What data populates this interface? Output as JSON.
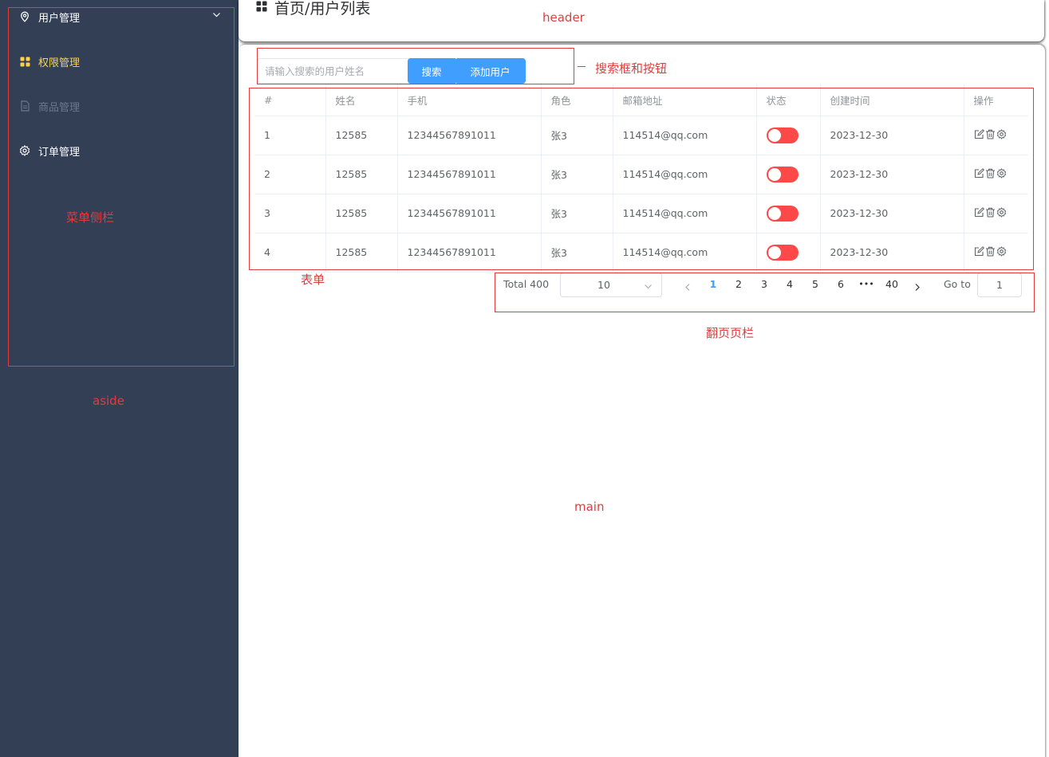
{
  "colors": {
    "aside_bg": "#323f55",
    "menu_active": "#ffd04b",
    "menu_disabled": "#6b778c",
    "primary": "#409eff",
    "switch_off": "#ff4949",
    "annotation": "#e23c3c"
  },
  "sidebar": {
    "items": [
      {
        "label": "用户管理",
        "icon": "location-icon",
        "has_submenu": true
      },
      {
        "label": "权限管理",
        "icon": "grid-icon",
        "active": true
      },
      {
        "label": "商品管理",
        "icon": "document-icon",
        "disabled": true
      },
      {
        "label": "订单管理",
        "icon": "gear-icon"
      }
    ]
  },
  "header": {
    "icon": "grid-icon",
    "breadcrumb": "首页/用户列表"
  },
  "search": {
    "placeholder": "请输入搜索的用户姓名",
    "value": "",
    "search_button": "搜索",
    "add_button": "添加用户"
  },
  "table": {
    "columns": [
      "#",
      "姓名",
      "手机",
      "角色",
      "邮箱地址",
      "状态",
      "创建时间",
      "操作"
    ],
    "rows": [
      {
        "index": "1",
        "name": "12585",
        "phone": "12344567891011",
        "role": "张3",
        "email": "114514@qq.com",
        "status": false,
        "created": "2023-12-30"
      },
      {
        "index": "2",
        "name": "12585",
        "phone": "12344567891011",
        "role": "张3",
        "email": "114514@qq.com",
        "status": false,
        "created": "2023-12-30"
      },
      {
        "index": "3",
        "name": "12585",
        "phone": "12344567891011",
        "role": "张3",
        "email": "114514@qq.com",
        "status": false,
        "created": "2023-12-30"
      },
      {
        "index": "4",
        "name": "12585",
        "phone": "12344567891011",
        "role": "张3",
        "email": "114514@qq.com",
        "status": false,
        "created": "2023-12-30"
      }
    ],
    "action_icons": [
      "edit-icon",
      "delete-icon",
      "settings-icon"
    ]
  },
  "pagination": {
    "total": "Total 400",
    "page_size": "10",
    "pages": [
      "1",
      "2",
      "3",
      "4",
      "5",
      "6",
      "•••",
      "40"
    ],
    "current_page": "1",
    "goto_label": "Go to",
    "goto_value": "1"
  },
  "annotations": {
    "header": "header",
    "search": "搜索框和按钮",
    "menu": "菜单侧栏",
    "aside": "aside",
    "table": "表单",
    "pagination": "翻页页栏",
    "main": "main"
  }
}
